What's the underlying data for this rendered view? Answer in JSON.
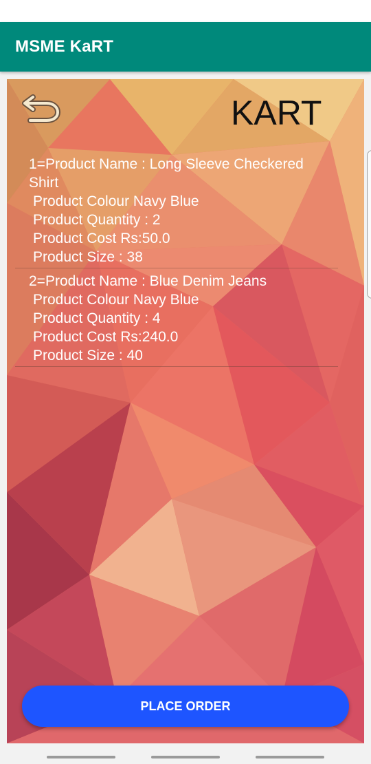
{
  "app_bar": {
    "title": "MSME KaRT"
  },
  "screen": {
    "title": "KART"
  },
  "icons": {
    "back": "back-arrow-icon"
  },
  "cart": {
    "items": [
      {
        "name_line": "1=Product Name : Long Sleeve Checkered Shirt",
        "colour_line": "Product Colour  Navy Blue",
        "quantity_line": "Product Quantity : 2",
        "cost_line": "Product Cost Rs:50.0",
        "size_line": "Product Size :  38"
      },
      {
        "name_line": "2=Product Name : Blue Denim Jeans",
        "colour_line": "Product Colour  Navy Blue",
        "quantity_line": "Product Quantity : 4",
        "cost_line": "Product Cost Rs:240.0",
        "size_line": "Product Size :  40"
      }
    ]
  },
  "actions": {
    "place_order": "PLACE ORDER"
  },
  "colors": {
    "app_bar": "#00897b",
    "primary_button": "#1e55ff",
    "text_on_bg": "#ffffff"
  }
}
